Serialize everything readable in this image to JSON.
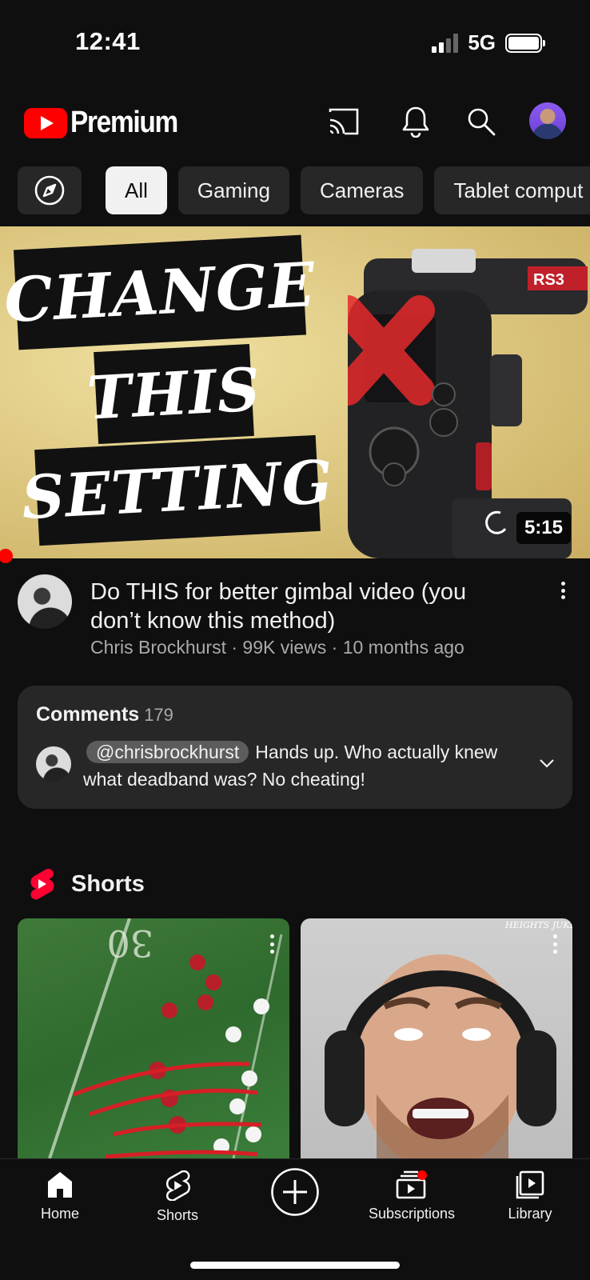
{
  "status_bar": {
    "time": "12:41",
    "network": "5G"
  },
  "app_bar": {
    "logo_text": "Premium",
    "icons": [
      "cast-icon",
      "bell-icon",
      "search-icon",
      "avatar"
    ]
  },
  "chips": {
    "explore_icon": "compass-icon",
    "items": [
      "All",
      "Gaming",
      "Cameras",
      "Tablet comput"
    ],
    "active": "All"
  },
  "video": {
    "thumbnail_words": [
      "CHANGE",
      "THIS",
      "SETTING"
    ],
    "gimbal_label": "RS3",
    "duration": "5:15",
    "title": "Do THIS for better gimbal video (you don’t know this method)",
    "channel": "Chris Brockhurst",
    "views": "99K views",
    "age": "10 months ago",
    "subtitle": "Chris Brockhurst · 99K views · 10 months ago"
  },
  "comments": {
    "label": "Comments",
    "count": "179",
    "handle": "@chrisbrockhurst",
    "text": "Hands up. Who actually knew what deadband was? No cheating!"
  },
  "shorts": {
    "title": "Shorts",
    "short1_overlay": "30",
    "short2_overlay": "HEIGHTS JUKES"
  },
  "bottom_nav": {
    "home": "Home",
    "shorts": "Shorts",
    "create_icon": "plus-circle-icon",
    "subscriptions": "Subscriptions",
    "library": "Library"
  },
  "colors": {
    "background": "#0f0f0f",
    "chip": "#272727",
    "accent": "#ff0000",
    "secondary_text": "#aaaaaa"
  }
}
